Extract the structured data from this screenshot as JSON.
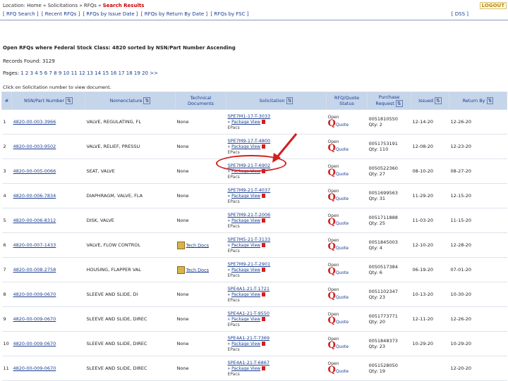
{
  "header": {
    "breadcrumb": [
      "Location: Home",
      "Solicitations",
      "RFQs",
      "Search Results"
    ],
    "logout": "LOGOUT",
    "nav": [
      "[ RFQ Search ]",
      "[ Recent RFQs ]",
      "[ RFQs by Issue Date ]",
      "[ RFQs by Return By Date ]",
      "[ RFQs by FSC ]"
    ],
    "dss": "[ DSS ]"
  },
  "summary": {
    "title": "Open RFQs where Federal Stock Class: 4820 sorted by NSN/Part Number Ascending",
    "records_found": "Records Found: 3129",
    "pages_label": "Pages:",
    "pages": [
      "1",
      "2",
      "3",
      "4",
      "5",
      "6",
      "7",
      "8",
      "9",
      "10",
      "11",
      "12",
      "13",
      "14",
      "15",
      "16",
      "17",
      "18",
      "19",
      "20",
      ">>"
    ],
    "hint": "Click on Solicitation number to view document."
  },
  "table": {
    "headers": [
      "#",
      "NSN/Part Number",
      "Nomenclature",
      "Technical Documents",
      "Solicitation",
      "RFQ/Quote Status",
      "Purchase Request",
      "Issued",
      "Return By"
    ],
    "rows": [
      {
        "n": "1",
        "nsn": "4820-00-003-3966",
        "nom": "VALVE, REGULATING, FL",
        "tech": "None",
        "sol": "SPE7M1-17-T-3033",
        "status": "Open",
        "pr": "0051810550",
        "qty": "Qty: 2",
        "issued": "12-14-20",
        "ret": "12-26-20"
      },
      {
        "n": "2",
        "nsn": "4820-00-003-9502",
        "nom": "VALVE, RELIEF, PRESSU",
        "tech": "None",
        "sol": "SPE7M9-17-T-4800",
        "status": "Open",
        "pr": "0051753191",
        "qty": "Qty: 110",
        "issued": "12-08-20",
        "ret": "12-23-20"
      },
      {
        "n": "3",
        "nsn": "4820-00-005-0066",
        "nom": "SEAT, VALVE",
        "tech": "None",
        "sol": "SPE7M9-21-T-6902",
        "status": "Open",
        "pr": "0050522360",
        "qty": "Qty: 27",
        "issued": "08-10-20",
        "ret": "08-27-20"
      },
      {
        "n": "4",
        "nsn": "4820-00-006-7834",
        "nom": "DIAPHRAGM, VALVE, FLA",
        "tech": "None",
        "sol": "SPE7M9-21-T-4037",
        "status": "Open",
        "pr": "0051699563",
        "qty": "Qty: 31",
        "issued": "11-29-20",
        "ret": "12-15-20"
      },
      {
        "n": "5",
        "nsn": "4820-00-006-8312",
        "nom": "DISK, VALVE",
        "tech": "None",
        "sol": "SPE7M9-21-T-2006",
        "status": "Open",
        "pr": "0051711888",
        "qty": "Qty: 25",
        "issued": "11-03-20",
        "ret": "11-15-20"
      },
      {
        "n": "6",
        "nsn": "4820-00-007-1433",
        "nom": "VALVE, FLOW CONTROL",
        "tech": "Tech Docs",
        "sol": "SPE7M5-21-T-3133",
        "status": "Open",
        "pr": "0051845003",
        "qty": "Qty: 4",
        "issued": "12-10-20",
        "ret": "12-28-20"
      },
      {
        "n": "7",
        "nsn": "4820-00-008-2758",
        "nom": "HOUSING, FLAPPER VAL",
        "tech": "Tech Docs",
        "sol": "SPE7M9-21-T-2901",
        "status": "Open",
        "pr": "0050517384",
        "qty": "Qty: 6",
        "issued": "06-19-20",
        "ret": "07-01-20"
      },
      {
        "n": "8",
        "nsn": "4820-00-009-0670",
        "nom": "SLEEVE AND SLIDE, DI",
        "tech": "None",
        "sol": "SPE4A1-21-T-1721",
        "status": "Open",
        "pr": "0051102347",
        "qty": "Qty: 23",
        "issued": "10-13-20",
        "ret": "10-30-20"
      },
      {
        "n": "9",
        "nsn": "4820-00-009-0670",
        "nom": "SLEEVE AND SLIDE, DIREC",
        "tech": "None",
        "sol": "SPE4A1-21-T-9550",
        "status": "Open",
        "pr": "0051773771",
        "qty": "Qty: 20",
        "issued": "12-11-20",
        "ret": "12-26-20"
      },
      {
        "n": "10",
        "nsn": "4820-00-009-0670",
        "nom": "SLEEVE AND SLIDE, DIREC",
        "tech": "None",
        "sol": "SPE4A1-21-T-7369",
        "status": "Open",
        "pr": "0051848373",
        "qty": "Qty: 23",
        "issued": "10-29-20",
        "ret": "10-29-20"
      },
      {
        "n": "11",
        "nsn": "4820-00-009-0670",
        "nom": "SLEEVE AND SLIDE, DIREC",
        "tech": "None",
        "sol": "SPE4A1-21-T-6867",
        "status": "Open",
        "pr": "0051528050",
        "qty": "Qty: 19",
        "issued": "",
        "ret": "12-20-20"
      }
    ],
    "package_view": "Package View",
    "epacs": "EPacs",
    "quote": "Quote"
  },
  "colors": {
    "header_bg": "#c5d5ea",
    "link": "#1a3d8f",
    "highlight": "#d21f1f"
  }
}
